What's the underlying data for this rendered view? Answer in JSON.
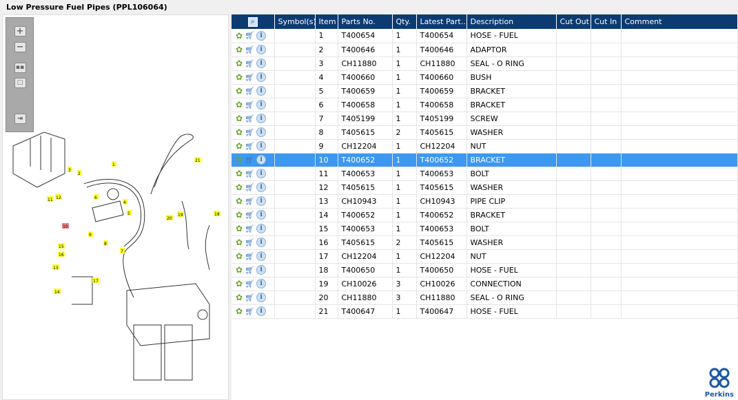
{
  "title": "Low Pressure Fuel Pipes (PPL106064)",
  "toolbar": [
    "zoom-in",
    "zoom-out",
    "fit",
    "actual-size",
    "export"
  ],
  "diagram_labels": [
    "1",
    "2",
    "3",
    "4",
    "5",
    "6",
    "7",
    "8",
    "9",
    "10",
    "11",
    "12",
    "13",
    "14",
    "15",
    "16",
    "17",
    "18",
    "19",
    "20",
    "21"
  ],
  "columns": [
    "",
    "Symbol(s)",
    "Item",
    "Parts No.",
    "Qty.",
    "Latest Part...",
    "Description",
    "Cut Out",
    "Cut In",
    "Comment"
  ],
  "rows": [
    [
      "1",
      "T400654",
      "1",
      "T400654",
      "HOSE - FUEL"
    ],
    [
      "2",
      "T400646",
      "1",
      "T400646",
      "ADAPTOR"
    ],
    [
      "3",
      "CH11880",
      "1",
      "CH11880",
      "SEAL - O RING"
    ],
    [
      "4",
      "T400660",
      "1",
      "T400660",
      "BUSH"
    ],
    [
      "5",
      "T400659",
      "1",
      "T400659",
      "BRACKET"
    ],
    [
      "6",
      "T400658",
      "1",
      "T400658",
      "BRACKET"
    ],
    [
      "7",
      "T405199",
      "1",
      "T405199",
      "SCREW"
    ],
    [
      "8",
      "T405615",
      "2",
      "T405615",
      "WASHER"
    ],
    [
      "9",
      "CH12204",
      "1",
      "CH12204",
      "NUT"
    ],
    [
      "10",
      "T400652",
      "1",
      "T400652",
      "BRACKET"
    ],
    [
      "11",
      "T400653",
      "1",
      "T400653",
      "BOLT"
    ],
    [
      "12",
      "T405615",
      "1",
      "T405615",
      "WASHER"
    ],
    [
      "13",
      "CH10943",
      "1",
      "CH10943",
      "PIPE CLIP"
    ],
    [
      "14",
      "T400652",
      "1",
      "T400652",
      "BRACKET"
    ],
    [
      "15",
      "T400653",
      "1",
      "T400653",
      "BOLT"
    ],
    [
      "16",
      "T405615",
      "2",
      "T405615",
      "WASHER"
    ],
    [
      "17",
      "CH12204",
      "1",
      "CH12204",
      "NUT"
    ],
    [
      "18",
      "T400650",
      "1",
      "T400650",
      "HOSE - FUEL"
    ],
    [
      "19",
      "CH10026",
      "3",
      "CH10026",
      "CONNECTION"
    ],
    [
      "20",
      "CH11880",
      "3",
      "CH11880",
      "SEAL - O RING"
    ],
    [
      "21",
      "T400647",
      "1",
      "T400647",
      "HOSE - FUEL"
    ]
  ],
  "selected_item": "10",
  "logo": "Perkins",
  "colors": {
    "header": "#0c3b72",
    "selected": "#3c98f0"
  }
}
